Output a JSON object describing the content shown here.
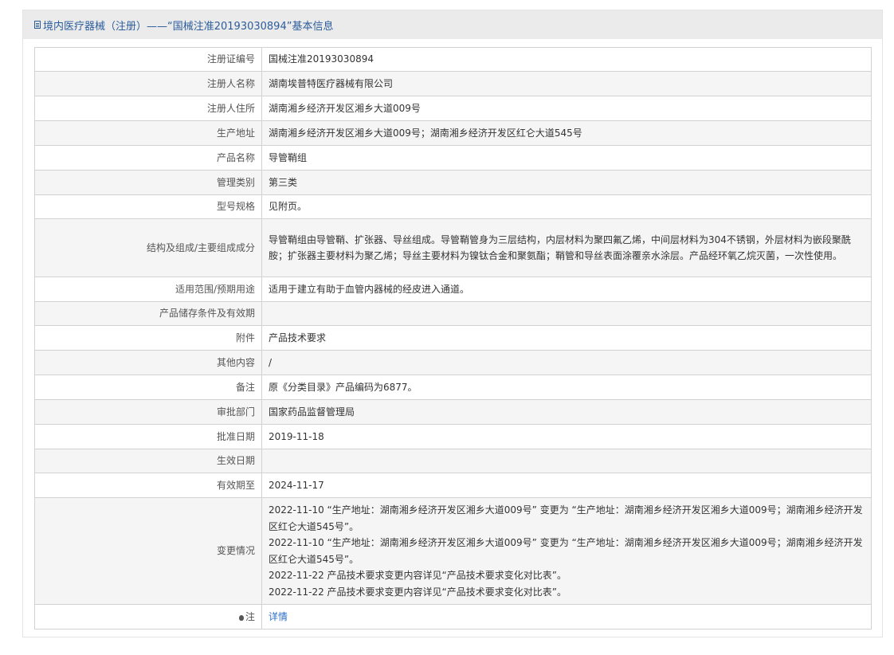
{
  "header": {
    "title": "境内医疗器械（注册）——“国械注准20193030894”基本信息"
  },
  "rows": [
    {
      "label": "注册证编号",
      "value": "国械注准20193030894"
    },
    {
      "label": "注册人名称",
      "value": "湖南埃普特医疗器械有限公司"
    },
    {
      "label": "注册人住所",
      "value": "湖南湘乡经济开发区湘乡大道009号"
    },
    {
      "label": "生产地址",
      "value": "湖南湘乡经济开发区湘乡大道009号；湖南湘乡经济开发区红仑大道545号"
    },
    {
      "label": "产品名称",
      "value": "导管鞘组"
    },
    {
      "label": "管理类别",
      "value": "第三类"
    },
    {
      "label": "型号规格",
      "value": "见附页。"
    },
    {
      "label": "结构及组成/主要组成成分",
      "value": "导管鞘组由导管鞘、扩张器、导丝组成。导管鞘管身为三层结构，内层材料为聚四氟乙烯，中间层材料为304不锈钢，外层材料为嵌段聚酰胺；扩张器主要材料为聚乙烯；导丝主要材料为镍钛合金和聚氨酯；鞘管和导丝表面涂覆亲水涂层。产品经环氧乙烷灭菌，一次性使用。"
    },
    {
      "label": "适用范围/预期用途",
      "value": "适用于建立有助于血管内器械的经皮进入通道。"
    },
    {
      "label": "产品储存条件及有效期",
      "value": ""
    },
    {
      "label": "附件",
      "value": "产品技术要求"
    },
    {
      "label": "其他内容",
      "value": "/"
    },
    {
      "label": "备注",
      "value": "原《分类目录》产品编码为6877。"
    },
    {
      "label": "审批部门",
      "value": "国家药品监督管理局"
    },
    {
      "label": "批准日期",
      "value": "2019-11-18"
    },
    {
      "label": "生效日期",
      "value": ""
    },
    {
      "label": "有效期至",
      "value": "2024-11-17"
    }
  ],
  "changes": {
    "label": "变更情况",
    "entries": [
      "2022-11-10 “生产地址：湖南湘乡经济开发区湘乡大道009号” 变更为 “生产地址：湖南湘乡经济开发区湘乡大道009号；湖南湘乡经济开发区红仑大道545号”。",
      "2022-11-10 “生产地址：湖南湘乡经济开发区湘乡大道009号” 变更为 “生产地址：湖南湘乡经济开发区湘乡大道009号；湖南湘乡经济开发区红仑大道545号”。",
      "2022-11-22 产品技术要求变更内容详见“产品技术要求变化对比表”。",
      "2022-11-22 产品技术要求变更内容详见“产品技术要求变化对比表”。"
    ]
  },
  "note": {
    "label": "注",
    "link_text": "详情",
    "icon": "lightbulb-icon"
  },
  "colors": {
    "header_text": "#2b5d9b",
    "link": "#2b6fc7",
    "alt_row": "#f5f5f5",
    "border": "#d2d2d2"
  }
}
